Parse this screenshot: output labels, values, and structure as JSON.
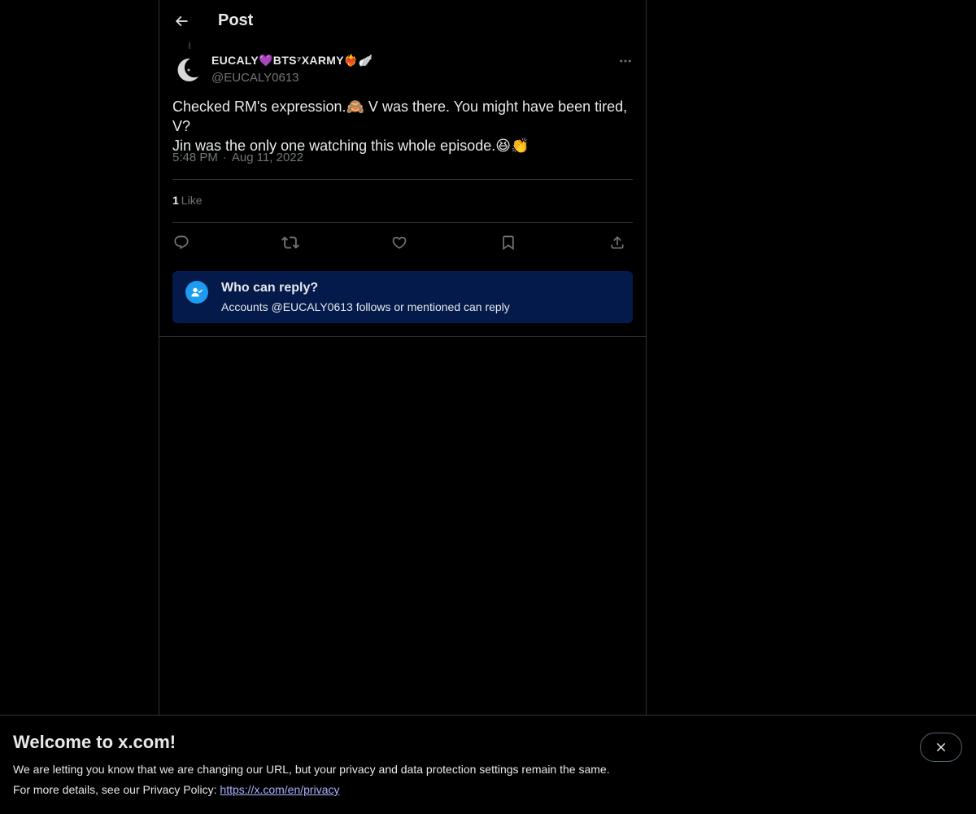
{
  "header": {
    "title": "Post",
    "back_icon": "arrow-left-icon"
  },
  "post": {
    "display_name": "EUCALY💜BTS⁷XARMY❤️‍🔥🪽",
    "handle": "@EUCALY0613",
    "text_line1": "Checked RM's expression.🙈 V was there. You might have been tired, V?",
    "text_line2": "Jin was the only one watching this whole episode.😆👏",
    "time": "5:48 PM",
    "separator": "·",
    "date": "Aug 11, 2022",
    "likes_count": "1",
    "likes_label": "Like"
  },
  "actions": [
    "reply-icon",
    "repost-icon",
    "like-icon",
    "bookmark-icon",
    "share-icon"
  ],
  "reply_restriction": {
    "title": "Who can reply?",
    "subtitle": "Accounts @EUCALY0613 follows or mentioned can reply"
  },
  "banner": {
    "title": "Welcome to x.com!",
    "line1": "We are letting you know that we are changing our URL, but your privacy and data protection settings remain the same.",
    "line2_prefix": "For more details, see our Privacy Policy: ",
    "link": "https://x.com/en/privacy"
  },
  "colors": {
    "background": "#000000",
    "text": "#e7e9ea",
    "muted": "#71767b",
    "accent": "#1d9bf0",
    "reply_box": "#031a4b",
    "link": "#a8b4ff"
  }
}
